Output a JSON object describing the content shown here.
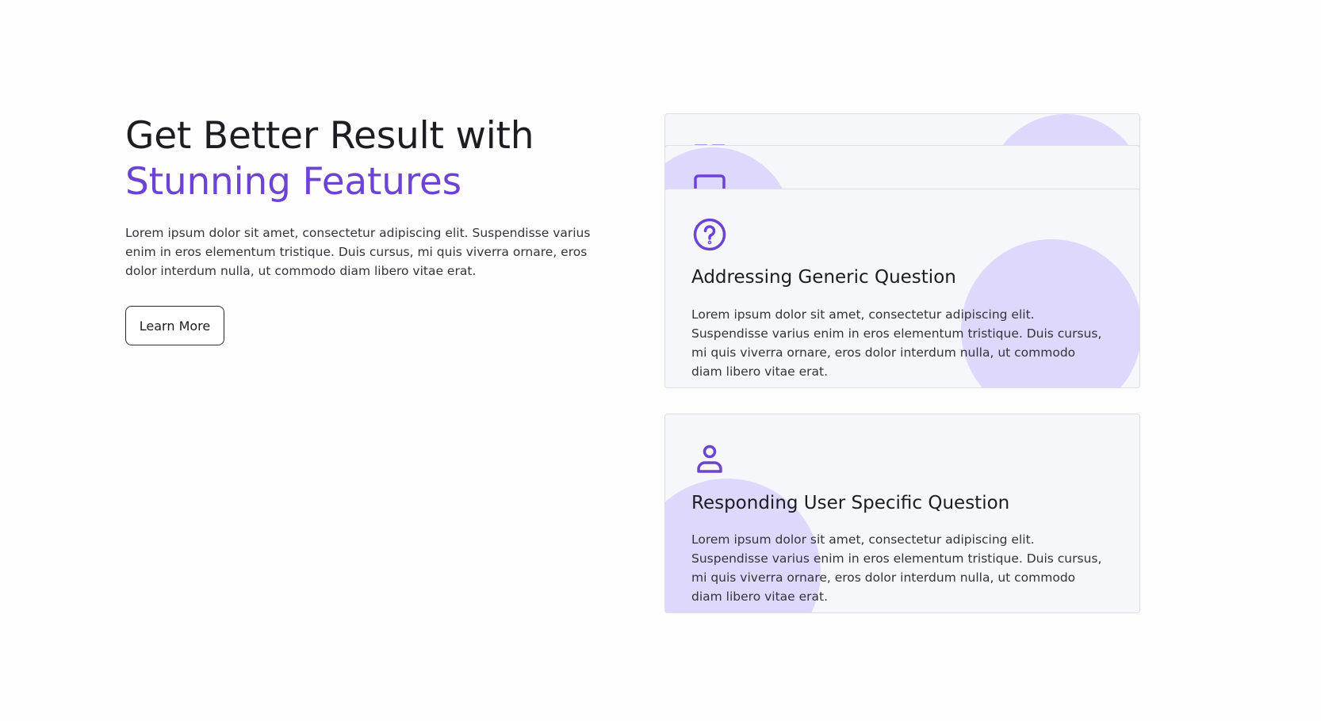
{
  "hero": {
    "title_line1": "Get Better Result with",
    "title_line2": "Stunning Features",
    "description": "Lorem ipsum dolor sit amet, consectetur adipiscing elit. Suspendisse varius enim in eros elementum tristique. Duis cursus, mi quis viverra ornare, eros dolor interdum nulla, ut commodo diam libero vitae erat.",
    "button_label": "Learn More"
  },
  "colors": {
    "accent": "#6c43d3",
    "card_background": "#f5f7fb",
    "circle": "#a793ff"
  },
  "cards": [
    {
      "icon": "grid-icon",
      "partially_hidden": true
    },
    {
      "icon": "chat-box-icon",
      "partially_hidden": true
    },
    {
      "icon": "question-circle-icon",
      "title": "Addressing Generic Question",
      "description": "Lorem ipsum dolor sit amet, consectetur adipiscing elit. Suspendisse varius enim in eros elementum tristique. Duis cursus, mi quis viverra ornare, eros dolor interdum nulla, ut commodo diam libero vitae erat."
    },
    {
      "icon": "user-icon",
      "title": "Responding User Specific Question",
      "description": "Lorem ipsum dolor sit amet, consectetur adipiscing elit. Suspendisse varius enim in eros elementum tristique. Duis cursus, mi quis viverra ornare, eros dolor interdum nulla, ut commodo diam libero vitae erat."
    }
  ]
}
